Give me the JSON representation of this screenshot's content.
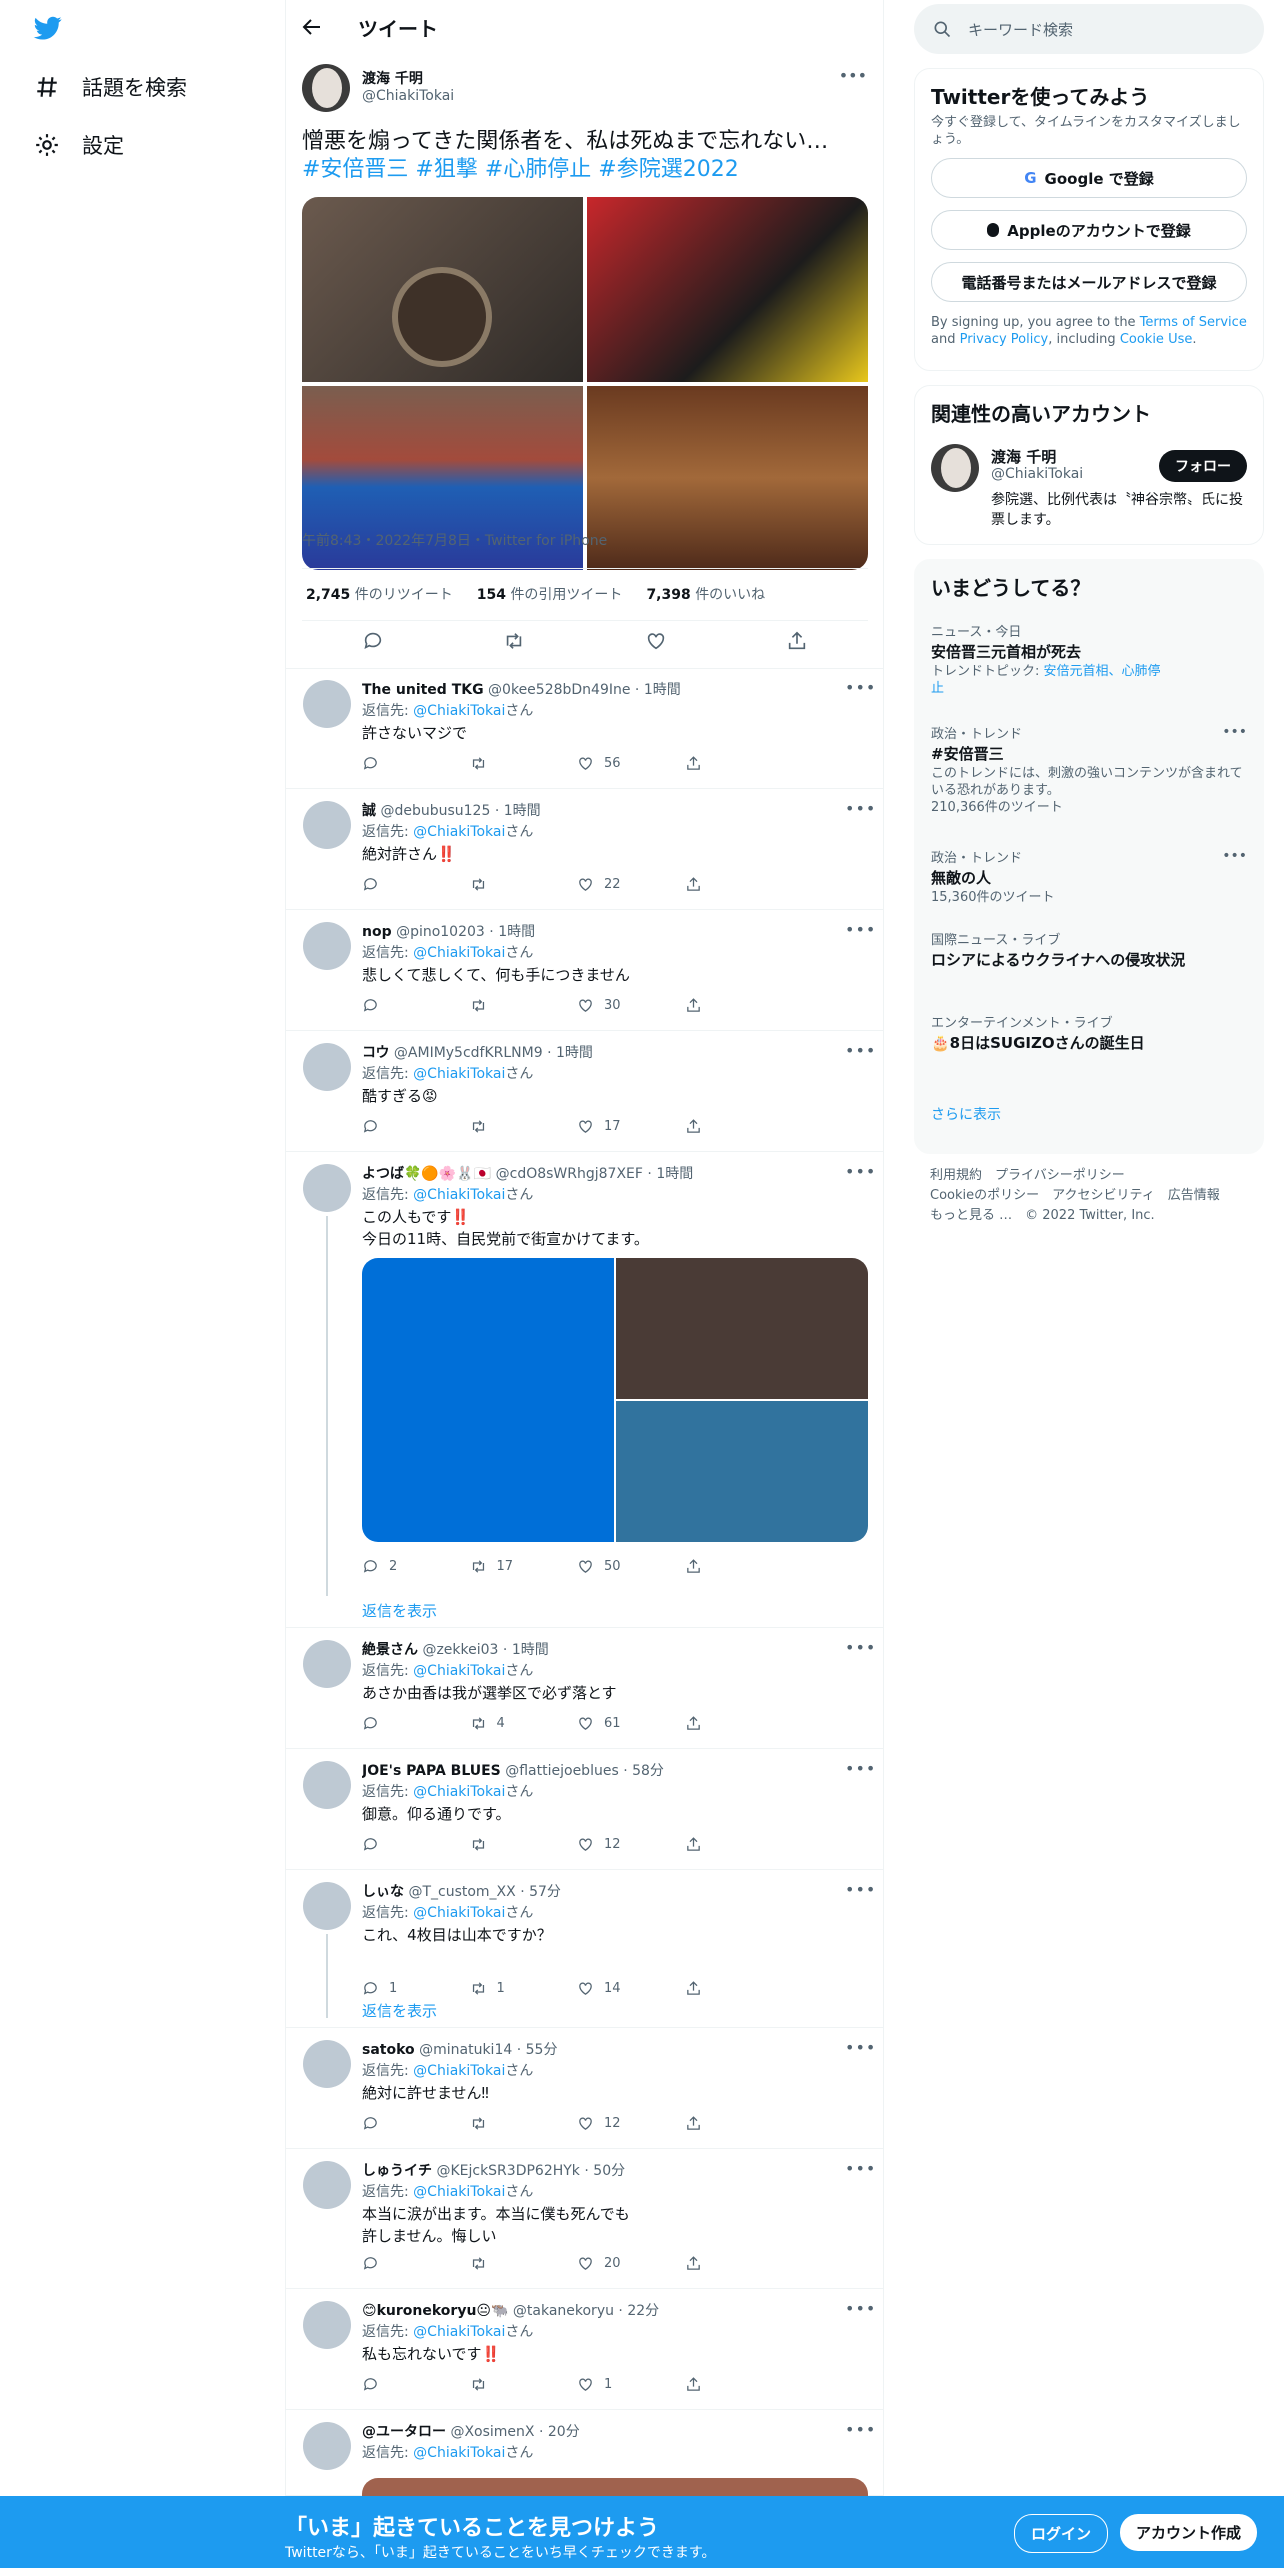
{
  "nav": {
    "explore": "話題を検索",
    "settings": "設定"
  },
  "header": {
    "title": "ツイート"
  },
  "tweet": {
    "name": "渡海 千明",
    "handle": "@ChiakiTokai",
    "text": "憎悪を煽ってきた関係者を、私は死ぬまで忘れない…",
    "hashtags": "#安倍晋三 #狙撃 #心肺停止 #参院選2022",
    "time": "午前8:43・2022年7月8日・Twitter for iPhone",
    "rt_count": "2,745",
    "rt_label": "件のリツイート",
    "qt_count": "154",
    "qt_label": "件の引用ツイート",
    "like_count": "7,398",
    "like_label": "件のいいね"
  },
  "replying_to": "返信先:",
  "mention": "@ChiakiTokai",
  "san": "さん",
  "show_replies": "返信を表示",
  "replies": [
    {
      "name": "The united TKG",
      "handle": "@0kee528bDn49Ine",
      "time": "1時間",
      "text": "許さないマジで",
      "replies": "",
      "retweets": "",
      "likes": "56"
    },
    {
      "name": "誠",
      "handle": "@debubusu125",
      "time": "1時間",
      "text": "絶対許さん‼️",
      "replies": "",
      "retweets": "",
      "likes": "22"
    },
    {
      "name": "nop",
      "handle": "@pino10203",
      "time": "1時間",
      "text": "悲しくて悲しくて、何も手につきません",
      "replies": "",
      "retweets": "",
      "likes": "30"
    },
    {
      "name": "コウ",
      "handle": "@AMIMy5cdfKRLNM9",
      "time": "1時間",
      "text": "酷すぎる😡",
      "replies": "",
      "retweets": "",
      "likes": "17"
    },
    {
      "name": "よつば🍀🟠🌸🐰🇯🇵",
      "handle": "@cdO8sWRhgj87XEF",
      "time": "1時間",
      "text": "この人もです‼️",
      "text2": "今日の11時、自民党前で街宣かけてます。",
      "replies": "2",
      "retweets": "17",
      "likes": "50"
    },
    {
      "name": "絶景さん",
      "handle": "@zekkei03",
      "time": "1時間",
      "text": "あさか由香は我が選挙区で必ず落とす",
      "replies": "",
      "retweets": "4",
      "likes": "61"
    },
    {
      "name": "JOE's PAPA BLUES",
      "handle": "@flattiejoeblues",
      "time": "58分",
      "text": "御意。仰る通りです。",
      "replies": "",
      "retweets": "",
      "likes": "12"
    },
    {
      "name": "しぃな",
      "handle": "@T_custom_XX",
      "time": "57分",
      "text": "これ、4枚目は山本ですか？",
      "replies": "1",
      "retweets": "1",
      "likes": "14"
    },
    {
      "name": "satoko",
      "handle": "@minatuki14",
      "time": "55分",
      "text": "絶対に許せません‼",
      "replies": "",
      "retweets": "",
      "likes": "12"
    },
    {
      "name": "しゅうイチ",
      "handle": "@KEjckSR3DP62HYk",
      "time": "50分",
      "text": "本当に涙が出ます。本当に僕も死んでも",
      "text2": "許しません。悔しい",
      "replies": "",
      "retweets": "",
      "likes": "20"
    },
    {
      "name": "😊kuronekoryu😐🐃",
      "handle": "@takanekoryu",
      "time": "22分",
      "text": "私も忘れないです‼️",
      "replies": "",
      "retweets": "",
      "likes": "1"
    },
    {
      "name": "@ユータロー",
      "handle": "@XosimenX",
      "time": "20分",
      "text": "",
      "replies": "",
      "retweets": "",
      "likes": ""
    }
  ],
  "search": {
    "placeholder": "キーワード検索"
  },
  "signup": {
    "title": "Twitterを使ってみよう",
    "subtitle": "今すぐ登録して、タイムラインをカスタマイズしましょう。",
    "google": "Google で登録",
    "apple": "Appleのアカウントで登録",
    "phone": "電話番号またはメールアドレスで登録",
    "legal1": "By signing up, you agree to the ",
    "tos": "Terms of Service",
    "and": " and ",
    "privacy": "Privacy Policy",
    "incl": ", including ",
    "cookie": "Cookie Use",
    "dot": "."
  },
  "related": {
    "title": "関連性の高いアカウント",
    "name": "渡海 千明",
    "handle": "@ChiakiTokai",
    "follow": "フォロー",
    "bio": "参院選、比例代表は〝神谷宗幣〟氏に投票します。"
  },
  "trends": {
    "title": "いまどうしてる？",
    "items": [
      {
        "meta": "ニュース・今日",
        "title": "安倍晋三元首相が死去",
        "sub_label": "トレンドトピック: ",
        "sub_link": "安倍元首相、心肺停止",
        "count": ""
      },
      {
        "meta": "政治・トレンド",
        "title": "#安倍晋三",
        "sub_label": "このトレンドには、刺激の強いコンテンツが含まれている恐れがあります。",
        "sub_link": "",
        "count": "210,366件のツイート"
      },
      {
        "meta": "政治・トレンド",
        "title": "無敵の人",
        "sub_label": "",
        "sub_link": "",
        "count": "15,360件のツイート"
      },
      {
        "meta": "国際ニュース・ライブ",
        "title": "ロシアによるウクライナへの侵攻状況",
        "sub_label": "",
        "sub_link": "",
        "count": ""
      },
      {
        "meta": "エンターテインメント・ライブ",
        "title": "🎂8日はSUGIZOさんの誕生日",
        "sub_label": "",
        "sub_link": "",
        "count": ""
      }
    ],
    "more": "さらに表示"
  },
  "footer": {
    "line1": "利用規約　プライバシーポリシー",
    "line2": "Cookieのポリシー　アクセシビリティ　広告情報",
    "line3": "もっと見る …　© 2022 Twitter, Inc."
  },
  "bottom": {
    "title": "「いま」起きていることを見つけよう",
    "subtitle": "Twitterなら、「いま」起きていることをいち早くチェックできます。",
    "login": "ログイン",
    "signup": "アカウント作成"
  },
  "colors": {
    "accent": "#1d9bf0",
    "bottom_bar": "#1d9bf0",
    "text": "#0f1419",
    "muted": "#536471"
  }
}
